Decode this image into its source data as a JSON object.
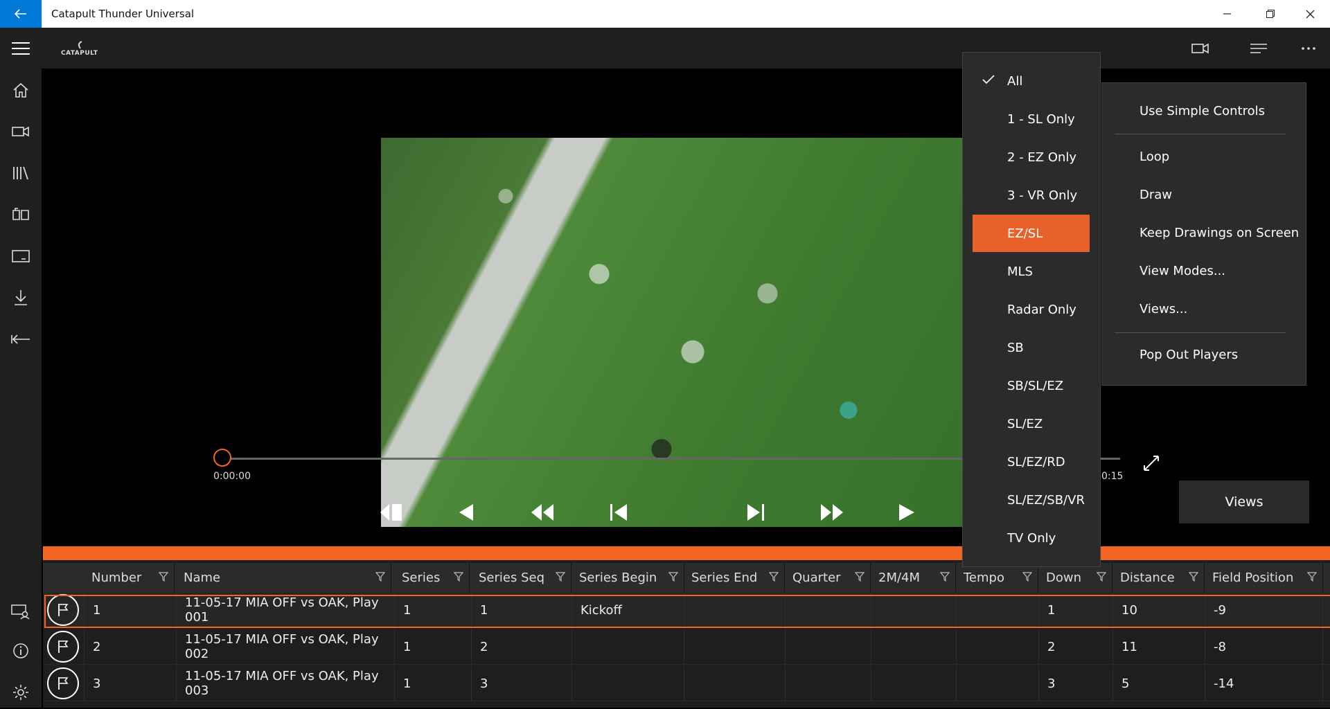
{
  "app": {
    "title": "Catapult Thunder Universal",
    "logo_text": "CATAPULT",
    "accent_color": "#f26522",
    "titlebar_accent": "#0078d7"
  },
  "window_controls": [
    "minimize-icon",
    "restore-icon",
    "close-icon"
  ],
  "top_icons": [
    "video-camera-icon",
    "list-icon",
    "more-icon"
  ],
  "sidebar": {
    "items": [
      {
        "icon": "home-icon"
      },
      {
        "icon": "video-icon"
      },
      {
        "icon": "library-icon"
      },
      {
        "icon": "playbook-icon"
      },
      {
        "icon": "screen-icon"
      },
      {
        "icon": "download-icon"
      },
      {
        "icon": "collapse-icon"
      }
    ],
    "bottom_items": [
      {
        "icon": "user-display-icon"
      },
      {
        "icon": "info-icon"
      },
      {
        "icon": "settings-icon"
      }
    ]
  },
  "player": {
    "time_start": "0:00:00",
    "time_end": "0:15",
    "progress": 0,
    "views_label": "Views",
    "controls": [
      "step-back-frame-icon",
      "previous-icon",
      "rewind-icon",
      "skip-start-icon",
      "skip-end-icon",
      "fast-forward-icon",
      "play-icon"
    ]
  },
  "view_mode_menu": {
    "items": [
      "All",
      "1 - SL Only",
      "2 - EZ Only",
      "3 - VR Only",
      "EZ/SL",
      "MLS",
      "Radar Only",
      "SB",
      "SB/SL/EZ",
      "SL/EZ",
      "SL/EZ/RD",
      "SL/EZ/SB/VR",
      "TV Only"
    ],
    "checked": "All",
    "highlighted": "EZ/SL"
  },
  "overflow_menu": {
    "items": [
      "Use Simple Controls",
      "Loop",
      "Draw",
      "Keep Drawings on Screen",
      "View Modes...",
      "Views...",
      "Pop Out Players"
    ]
  },
  "grid": {
    "columns": [
      "Number",
      "Name",
      "Series",
      "Series Seq",
      "Series Begin",
      "Series End",
      "Quarter",
      "2M/4M",
      "Tempo",
      "Down",
      "Distance",
      "Field Position"
    ],
    "rows": [
      {
        "number": "1",
        "name": "11-05-17 MIA OFF vs OAK, Play 001",
        "series": "1",
        "series_seq": "1",
        "series_begin": "Kickoff",
        "series_end": "",
        "quarter": "",
        "two_four": "",
        "tempo": "",
        "down": "1",
        "distance": "10",
        "field_position": "-9"
      },
      {
        "number": "2",
        "name": "11-05-17 MIA OFF vs OAK, Play 002",
        "series": "1",
        "series_seq": "2",
        "series_begin": "",
        "series_end": "",
        "quarter": "",
        "two_four": "",
        "tempo": "",
        "down": "2",
        "distance": "11",
        "field_position": "-8"
      },
      {
        "number": "3",
        "name": "11-05-17 MIA OFF vs OAK, Play 003",
        "series": "1",
        "series_seq": "3",
        "series_begin": "",
        "series_end": "",
        "quarter": "",
        "two_four": "",
        "tempo": "",
        "down": "3",
        "distance": "5",
        "field_position": "-14"
      }
    ]
  }
}
